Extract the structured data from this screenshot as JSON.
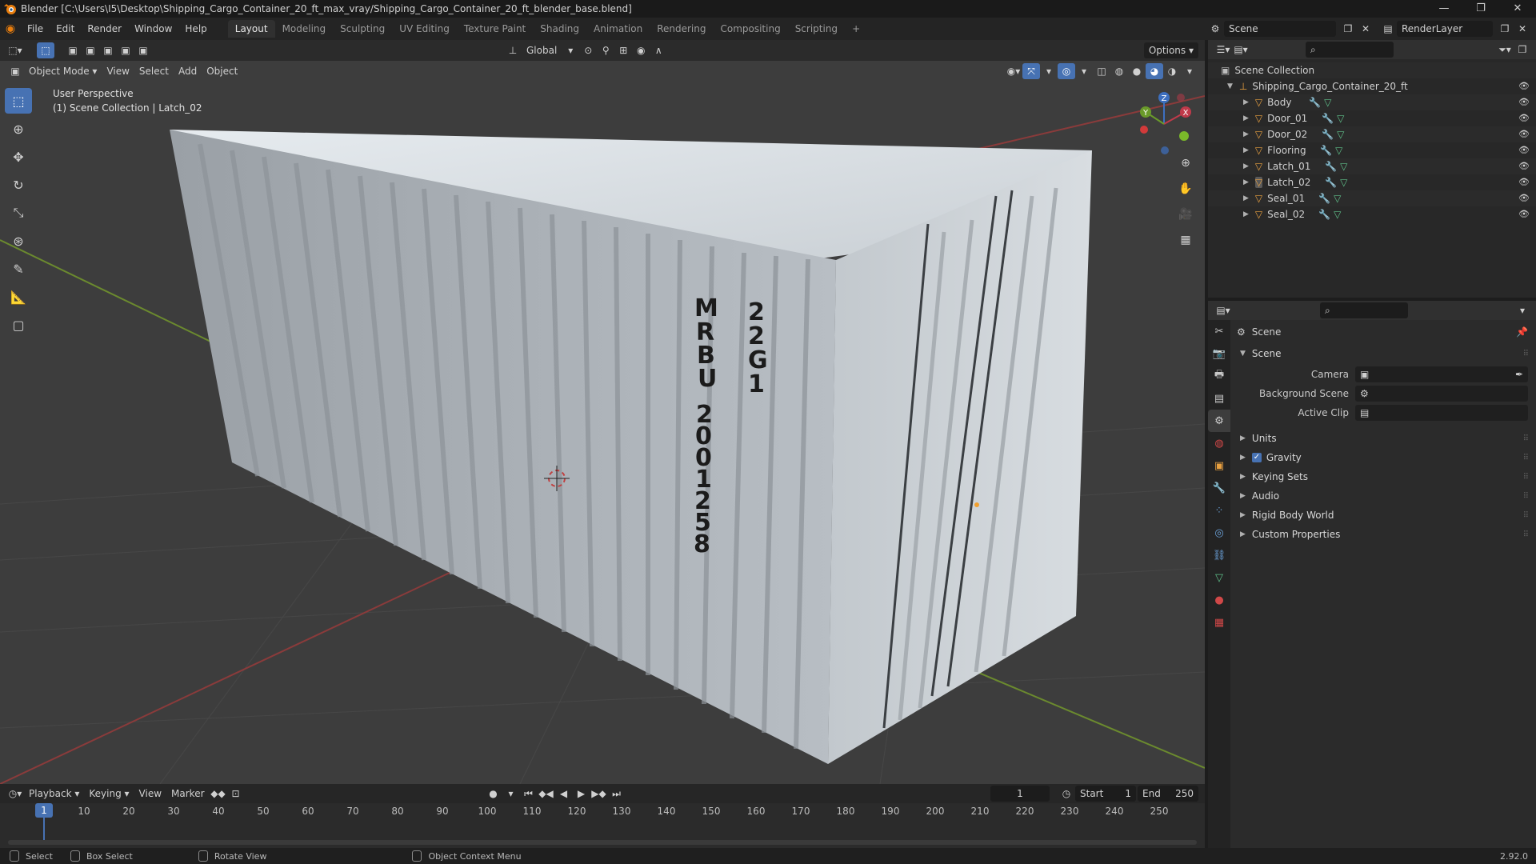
{
  "window": {
    "title": "Blender [C:\\Users\\I5\\Desktop\\Shipping_Cargo_Container_20_ft_max_vray/Shipping_Cargo_Container_20_ft_blender_base.blend]",
    "controls": [
      "—",
      "❐",
      "✕"
    ]
  },
  "menu": [
    "File",
    "Edit",
    "Render",
    "Window",
    "Help"
  ],
  "workspaces": [
    "Layout",
    "Modeling",
    "Sculpting",
    "UV Editing",
    "Texture Paint",
    "Shading",
    "Animation",
    "Rendering",
    "Compositing",
    "Scripting",
    "+"
  ],
  "active_workspace": "Layout",
  "scene_field": "Scene",
  "view_layer_field": "RenderLayer",
  "viewport": {
    "mode": "Object Mode",
    "menus": [
      "View",
      "Select",
      "Add",
      "Object"
    ],
    "transform_orientation": "Global",
    "options_label": "Options",
    "info_line1": "User Perspective",
    "info_line2": "(1) Scene Collection | Latch_02",
    "container_text_left": [
      "M",
      "R",
      "B",
      "U",
      "2",
      "0",
      "0",
      "1",
      "2",
      "5",
      "8"
    ],
    "container_text_right": [
      "2",
      "2",
      "G",
      "1"
    ],
    "axes": [
      "X",
      "Y",
      "Z"
    ],
    "accent": "#4772b3"
  },
  "tools": [
    "select-box",
    "cursor",
    "move",
    "rotate",
    "scale",
    "transform",
    "annotate",
    "measure",
    "add-cube"
  ],
  "timeline": {
    "menus": [
      "Playback",
      "Keying",
      "View",
      "Marker"
    ],
    "current_frame": "1",
    "start_label": "Start",
    "start": "1",
    "end_label": "End",
    "end": "250",
    "ticks": [
      "10",
      "20",
      "30",
      "40",
      "50",
      "60",
      "70",
      "80",
      "90",
      "100",
      "110",
      "120",
      "130",
      "140",
      "150",
      "160",
      "170",
      "180",
      "190",
      "200",
      "210",
      "220",
      "230",
      "240",
      "250"
    ],
    "playhead_label": "1"
  },
  "outliner": {
    "root": "Scene Collection",
    "collection": "Shipping_Cargo_Container_20_ft",
    "objects": [
      "Body",
      "Door_01",
      "Door_02",
      "Flooring",
      "Latch_01",
      "Latch_02",
      "Seal_01",
      "Seal_02"
    ]
  },
  "properties": {
    "context": "Scene",
    "panel": "Scene",
    "fields": [
      {
        "label": "Camera",
        "value": ""
      },
      {
        "label": "Background Scene",
        "value": ""
      },
      {
        "label": "Active Clip",
        "value": ""
      }
    ],
    "subpanels": [
      "Units",
      "Gravity",
      "Keying Sets",
      "Audio",
      "Rigid Body World",
      "Custom Properties"
    ],
    "gravity_checked": true
  },
  "statusbar": {
    "items": [
      "Select",
      "Box Select",
      "Rotate View",
      "Object Context Menu"
    ],
    "version": "2.92.0"
  }
}
